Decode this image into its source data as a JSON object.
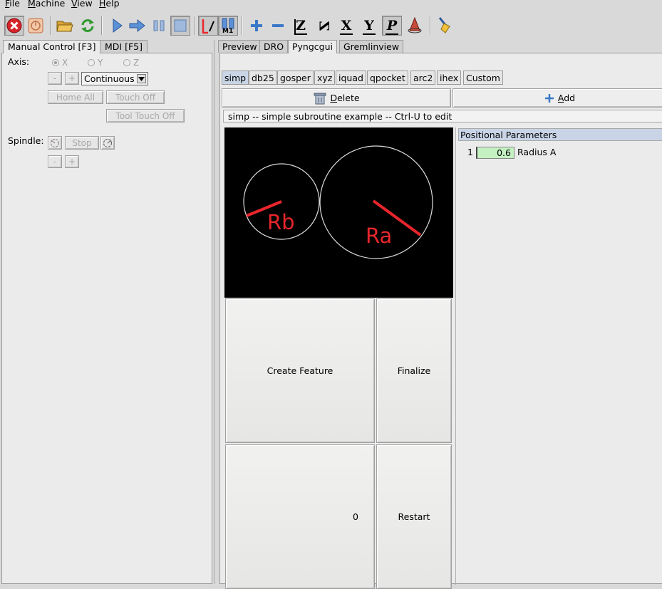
{
  "menubar": {
    "items": [
      {
        "label": "File",
        "u": "F",
        "rest": "ile"
      },
      {
        "label": "Machine",
        "u": "M",
        "rest": "achine"
      },
      {
        "label": "View",
        "u": "V",
        "rest": "iew"
      },
      {
        "label": "Help",
        "u": "H",
        "rest": "elp"
      }
    ]
  },
  "toolbar": {
    "letters": {
      "z": "Z",
      "z_flip": "Z",
      "x": "X",
      "y": "Y",
      "p": "P"
    },
    "m1_label": "M1"
  },
  "left": {
    "tabs": [
      "Manual Control [F3]",
      "MDI [F5]"
    ],
    "axis_label": "Axis:",
    "axes": [
      "X",
      "Y",
      "Z"
    ],
    "minus": "-",
    "plus": "+",
    "jog_mode": "Continuous",
    "home_all": "Home All",
    "touch_off": "Touch Off",
    "tool_touch_off": "Tool Touch Off",
    "spindle_label": "Spindle:",
    "stop": "Stop"
  },
  "right": {
    "tabs": [
      "Preview",
      "DRO",
      "Pyngcgui",
      "Gremlinview"
    ],
    "subtabs": [
      "simp",
      "db25",
      "gosper",
      "xyz",
      "iquad",
      "qpocket",
      "arc2",
      "ihex",
      "Custom"
    ],
    "delete_u": "D",
    "delete_rest": "elete",
    "add_u": "A",
    "add_rest": "dd",
    "info": "simp -- simple subroutine example -- Ctrl-U to edit",
    "params_header": "Positional Parameters",
    "params": [
      {
        "index": "1",
        "value": "0.6",
        "label": "Radius A"
      }
    ],
    "preview_labels": {
      "small": "Rb",
      "large": "Ra"
    },
    "create_feature": "Create Feature",
    "finalize": "Finalize",
    "counter": "0",
    "restart": "Restart"
  },
  "colors": {
    "preview_red": "#e8262c",
    "param_green": "#c4f0c2",
    "selected_tab": "#c9d5e6"
  }
}
